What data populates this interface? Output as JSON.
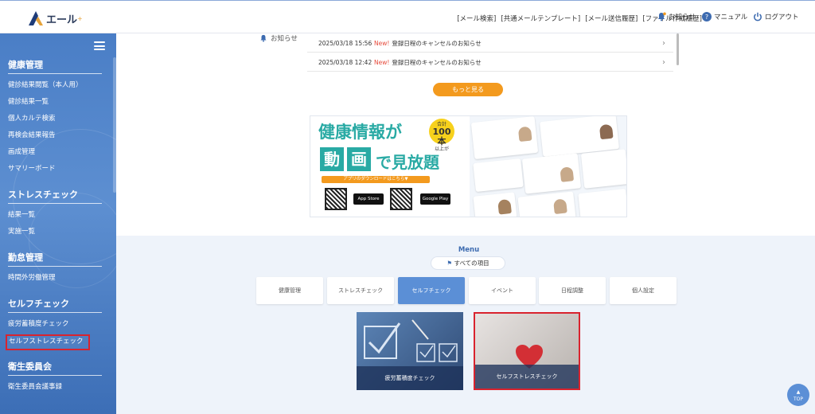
{
  "header": {
    "logo_text": "エール",
    "logo_sup": "+",
    "links": [
      "[メール検索]",
      "[共通メールテンプレート]",
      "[メール送信履歴]",
      "[ファイル作成履歴]"
    ],
    "notice": "お知らせ",
    "manual": "マニュアル",
    "logout": "ログアウト"
  },
  "sidebar": {
    "sections": [
      {
        "title": "健康管理",
        "items": [
          "健診結果閲覧（本人用）",
          "健診結果一覧",
          "個人カルテ検索",
          "再検会結果報告",
          "画成管理",
          "サマリーボード"
        ]
      },
      {
        "title": "ストレスチェック",
        "items": [
          "結果一覧",
          "実施一覧"
        ]
      },
      {
        "title": "勤怠管理",
        "items": [
          "時間外労働管理"
        ]
      },
      {
        "title": "セルフチェック",
        "items": [
          "疲労蓄積度チェック",
          "セルフストレスチェック"
        ]
      },
      {
        "title": "衛生委員会",
        "items": [
          "衛生委員会議事録"
        ]
      }
    ]
  },
  "news": {
    "label": "お知らせ",
    "rows": [
      {
        "date": "2025/03/18 15:56",
        "new": "New!",
        "title": "登録日程のキャンセルのお知らせ"
      },
      {
        "date": "2025/03/18 12:42",
        "new": "New!",
        "title": "登録日程のキャンセルのお知らせ"
      }
    ],
    "more": "もっと見る"
  },
  "banner": {
    "title1": "健康情報が",
    "badge_top": "合計",
    "badge_num": "100本",
    "badge_bottom": "以上が",
    "k1": "動",
    "k2": "画",
    "title2": "で見放題",
    "download": "アプリのダウンロードはこちら▼",
    "store1": "App Store",
    "store2": "Google Play"
  },
  "menu": {
    "title": "Menu",
    "all_items": "すべての項目",
    "tabs": [
      "健康管理",
      "ストレスチェック",
      "セルフチェック",
      "イベント",
      "日程調整",
      "個人設定"
    ],
    "selected_tab": "セルフチェック",
    "tiles": [
      {
        "caption": "疲労蓄積度チェック"
      },
      {
        "caption": "セルフストレスチェック"
      }
    ]
  },
  "top_button": "TOP",
  "colors": {
    "accent": "#5b8fd6",
    "orange": "#f39a1e",
    "highlight": "#d9232e",
    "teal": "#29aaa4"
  }
}
